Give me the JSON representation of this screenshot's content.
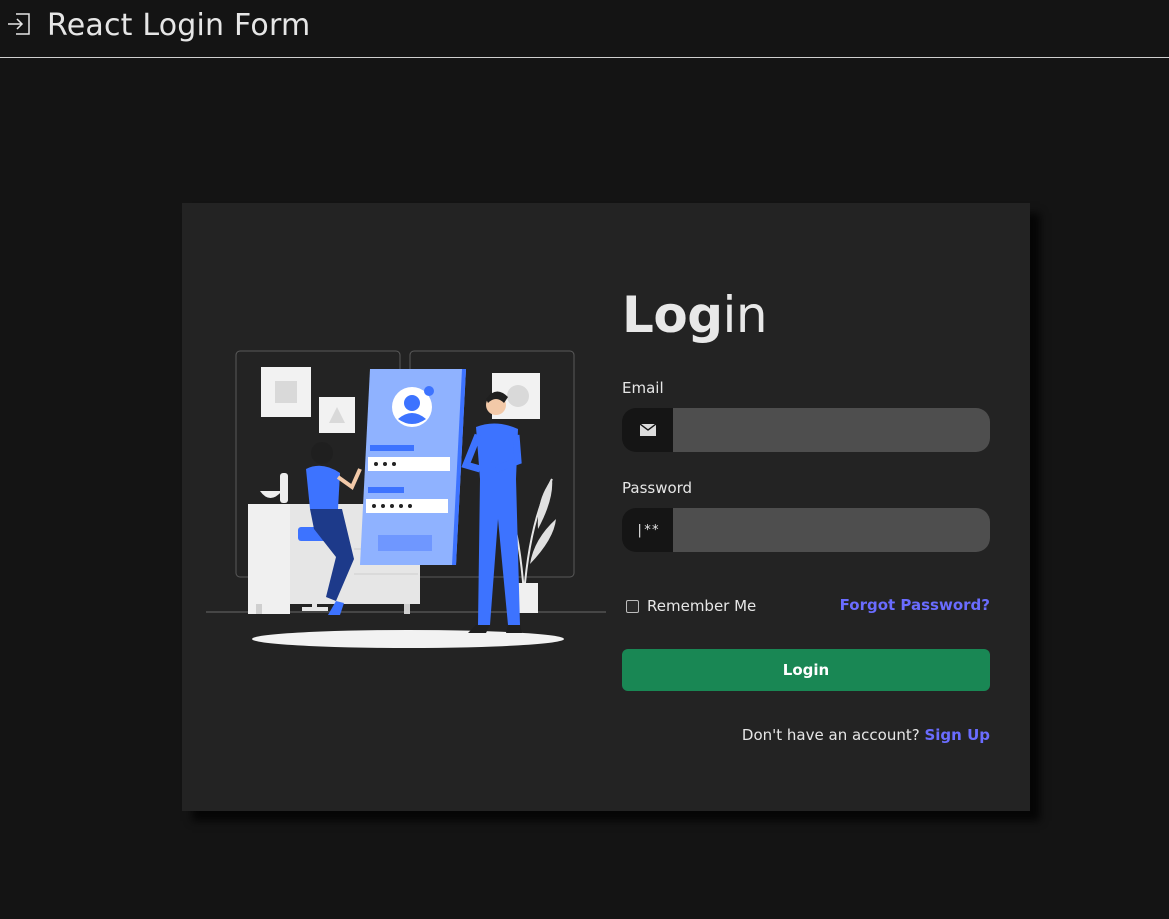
{
  "app": {
    "title": "React Login Form",
    "icon": "login-icon"
  },
  "login": {
    "heading_bold": "Log",
    "heading_mid": "g",
    "heading_light": "in",
    "email_label": "Email",
    "email_value": "",
    "email_icon": "envelope-icon",
    "password_label": "Password",
    "password_value": "",
    "password_icon": "password-icon",
    "password_icon_text": "|**",
    "remember_label": "Remember Me",
    "remember_checked": false,
    "forgot_label": "Forgot Password?",
    "submit_label": "Login",
    "signup_prompt": "Don't have an account?",
    "signup_label": "Sign Up"
  },
  "colors": {
    "page_bg": "#141414",
    "card_bg": "#232323",
    "input_bg": "#4e4e4e",
    "icon_bg": "#151515",
    "button": "#198754",
    "link": "#6a6cff",
    "illustration_accent": "#3d73ff"
  }
}
